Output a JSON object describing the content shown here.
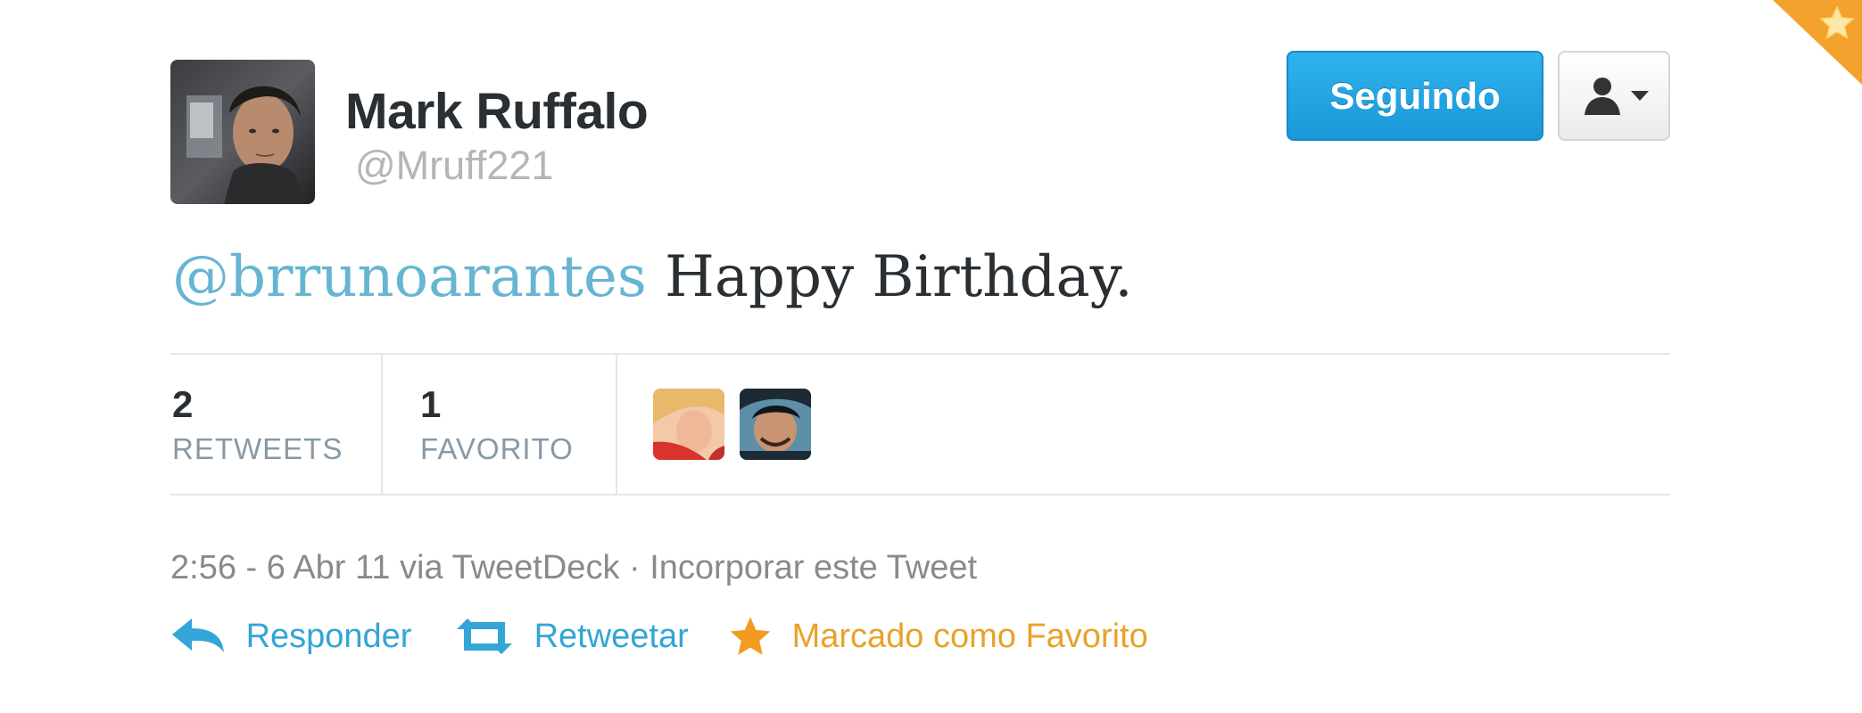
{
  "tweet": {
    "author": {
      "display_name": "Mark Ruffalo",
      "screen_name": "@Mruff221"
    },
    "follow_button": "Seguindo",
    "text": {
      "mention": "@brrunoarantes",
      "body": " Happy Birthday."
    },
    "stats": {
      "retweets": {
        "count": "2",
        "label": "RETWEETS"
      },
      "favorites": {
        "count": "1",
        "label": "FAVORITO"
      }
    },
    "meta": {
      "timestamp": "2:56 - 6 Abr 11",
      "via_prefix": " via ",
      "source": "TweetDeck",
      "separator": " · ",
      "embed": "Incorporar este Tweet"
    },
    "actions": {
      "reply": "Responder",
      "retweet": "Retweetar",
      "favorited": "Marcado como Favorito"
    }
  },
  "colors": {
    "link_blue": "#66b5d2",
    "follow_blue": "#1a97d8",
    "favorite_orange": "#f3a22d",
    "text_dark": "#292f33",
    "text_muted": "#8a8a8a"
  },
  "icons": {
    "corner": "star-icon",
    "dropdown": "person-icon",
    "reply": "reply-arrow-icon",
    "retweet": "retweet-icon",
    "favorite": "star-icon"
  }
}
